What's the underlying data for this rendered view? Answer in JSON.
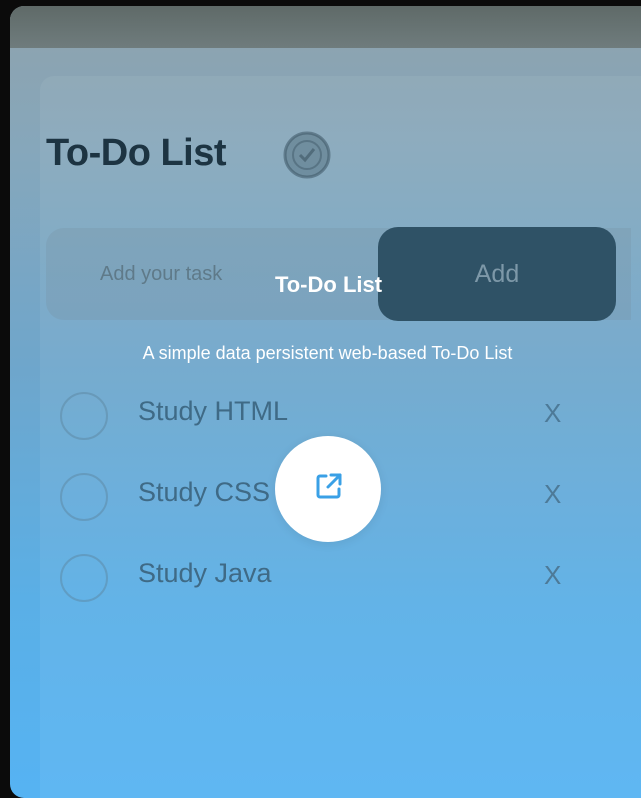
{
  "app": {
    "title": "To-Do List",
    "title_icon": "checkmark-badge-icon"
  },
  "input": {
    "placeholder": "Add your task",
    "value": ""
  },
  "add_button": {
    "label": "Add"
  },
  "tasks": [
    {
      "text": "Study HTML",
      "delete_label": "X",
      "checked": false
    },
    {
      "text": "Study CSS",
      "delete_label": "X",
      "checked": false
    },
    {
      "text": "Study Java",
      "delete_label": "X",
      "checked": false
    }
  ],
  "overlay": {
    "title": "To-Do List",
    "description": "A simple data persistent web-based To-Do List",
    "link_icon": "open-external-icon"
  },
  "colors": {
    "accent": "#2f5266",
    "link_icon": "#3aa0e6",
    "gradient_bottom": "#56b3f3"
  }
}
